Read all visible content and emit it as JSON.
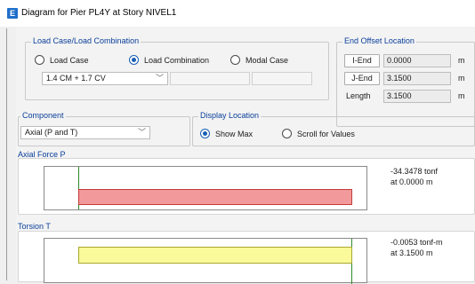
{
  "window": {
    "title": "Diagram for Pier PL4Y at Story NIVEL1",
    "icon": "E"
  },
  "load_case_group": {
    "title": "Load Case/Load Combination",
    "options": [
      {
        "label": "Load Case",
        "selected": false
      },
      {
        "label": "Load Combination",
        "selected": true
      },
      {
        "label": "Modal Case",
        "selected": false
      }
    ],
    "selected_combination": "1.4 CM + 1.7 CV"
  },
  "end_offset": {
    "title": "End Offset Location",
    "i_end_label": "I-End",
    "i_end_value": "0.0000",
    "j_end_label": "J-End",
    "j_end_value": "3.1500",
    "length_label": "Length",
    "length_value": "3.1500",
    "unit": "m"
  },
  "component": {
    "title": "Component",
    "selected": "Axial (P and T)"
  },
  "display_location": {
    "title": "Display Location",
    "options": [
      {
        "label": "Show Max",
        "selected": true
      },
      {
        "label": "Scroll for Values",
        "selected": false
      }
    ]
  },
  "axial": {
    "title": "Axial Force P",
    "value": "-34.3478 tonf",
    "location": "at 0.0000 m",
    "fill_color": "#f2999b",
    "border_color": "#c43a3a"
  },
  "torsion": {
    "title": "Torsion T",
    "value": "-0.0053 tonf-m",
    "location": "at 3.1500 m",
    "fill_color": "#fafa9a",
    "border_color": "#a8a830"
  }
}
